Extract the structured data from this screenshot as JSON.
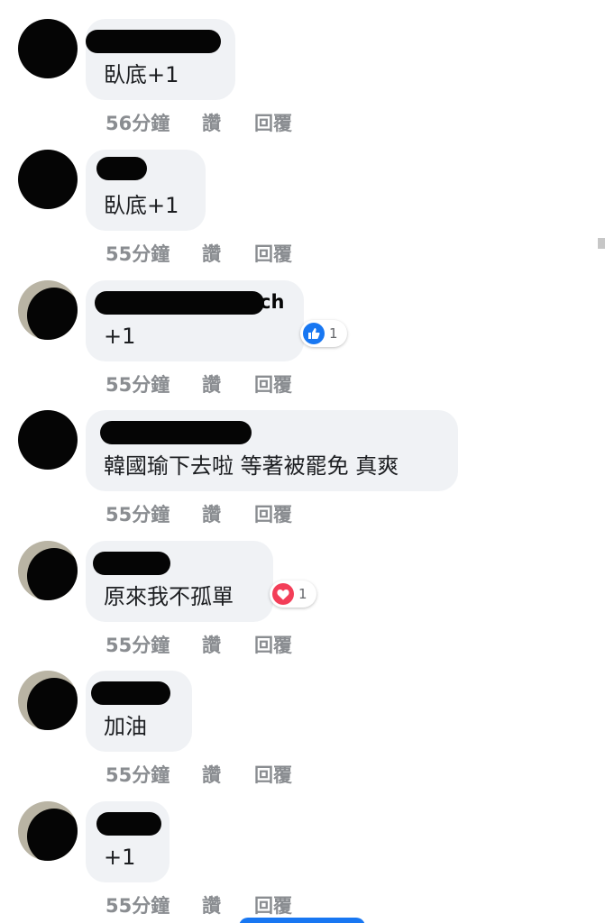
{
  "comments": [
    {
      "text": "臥底+1",
      "time": "56分鐘",
      "like_label": "讚",
      "reply_label": "回覆"
    },
    {
      "text": "臥底+1",
      "time": "55分鐘",
      "like_label": "讚",
      "reply_label": "回覆"
    },
    {
      "name_fragment": "ch",
      "text": "+1",
      "time": "55分鐘",
      "like_label": "讚",
      "reply_label": "回覆",
      "reaction": {
        "icon": "like-icon",
        "count": "1"
      }
    },
    {
      "text": "韓國瑜下去啦 等著被罷免 真爽",
      "time": "55分鐘",
      "like_label": "讚",
      "reply_label": "回覆"
    },
    {
      "text": "原來我不孤單",
      "time": "55分鐘",
      "like_label": "讚",
      "reply_label": "回覆",
      "reaction": {
        "icon": "love-icon",
        "count": "1"
      }
    },
    {
      "text": "加油",
      "time": "55分鐘",
      "like_label": "讚",
      "reply_label": "回覆"
    },
    {
      "text": "+1",
      "time": "55分鐘",
      "like_label": "讚",
      "reply_label": "回覆"
    }
  ]
}
